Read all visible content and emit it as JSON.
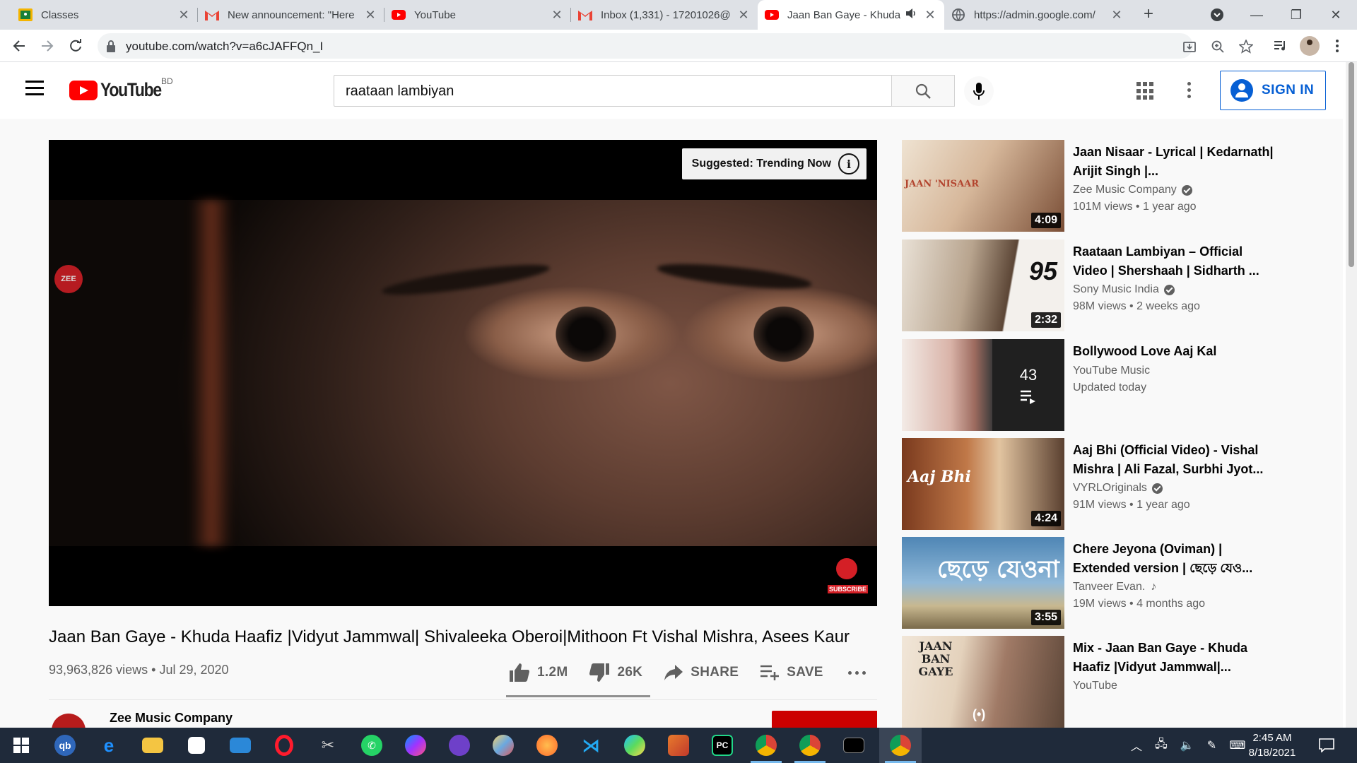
{
  "browser": {
    "tabs": [
      {
        "title": "Classes",
        "favicon": "classroom-icon",
        "active": false
      },
      {
        "title": "New announcement: \"Here",
        "favicon": "gmail-icon",
        "active": false
      },
      {
        "title": "YouTube",
        "favicon": "youtube-icon",
        "active": false
      },
      {
        "title": "Inbox (1,331) - 17201026@",
        "favicon": "gmail-icon",
        "active": false
      },
      {
        "title": "Jaan Ban Gaye - Khuda",
        "favicon": "youtube-icon",
        "active": true,
        "muted_icon": "speaker-icon"
      },
      {
        "title": "https://admin.google.com/",
        "favicon": "globe-icon",
        "active": false
      }
    ],
    "url": "youtube.com/watch?v=a6cJAFFQn_I"
  },
  "youtube": {
    "logo_text": "YouTube",
    "country_code": "BD",
    "search_query": "raataan lambiyan",
    "sign_in_label": "SIGN IN"
  },
  "player": {
    "suggested_label": "Suggested: Trending Now",
    "info_glyph": "i",
    "zee_logo": "ZEE",
    "subscribe_overlay": "SUBSCRIBE"
  },
  "video": {
    "title": "Jaan Ban Gaye - Khuda Haafiz |Vidyut Jammwal| Shivaleeka Oberoi|Mithoon Ft Vishal Mishra, Asees Kaur",
    "views": "93,963,826 views",
    "date": "Jul 29, 2020",
    "likes": "1.2M",
    "dislikes": "26K",
    "share_label": "SHARE",
    "save_label": "SAVE",
    "like_ratio": 0.979,
    "channel_name": "Zee Music Company"
  },
  "recommendations": [
    {
      "title": "Jaan Nisaar - Lyrical | Kedarnath| Arijit Singh |...",
      "channel": "Zee Music Company",
      "verified": true,
      "stats": "101M views • 1 year ago",
      "duration": "4:09",
      "thumb_text": "JAAN 'NISAAR",
      "thumb_colors": [
        "#d8c2a8",
        "#9a6a4a"
      ]
    },
    {
      "title": "Raataan Lambiyan – Official Video | Shershaah | Sidharth ...",
      "channel": "Sony Music India",
      "verified": true,
      "stats": "98M views • 2 weeks ago",
      "duration": "2:32",
      "thumb_text": "95",
      "thumb_colors": [
        "#c7b9a4",
        "#6b5a4a"
      ]
    },
    {
      "title": "Bollywood Love Aaj Kal",
      "channel": "YouTube Music",
      "verified": false,
      "stats": "Updated today",
      "playlist_count": "43",
      "thumb_colors": [
        "#e8d8d0",
        "#b88a7a"
      ]
    },
    {
      "title": "Aaj Bhi (Official Video) - Vishal Mishra | Ali Fazal, Surbhi Jyot...",
      "channel": "VYRLOriginals",
      "verified": true,
      "stats": "91M views • 1 year ago",
      "duration": "4:24",
      "thumb_text": "Aaj Bhi",
      "thumb_colors": [
        "#8a4a2a",
        "#d8a070"
      ]
    },
    {
      "title": "Chere Jeyona (Oviman) | Extended version | ছেড়ে যেও...",
      "channel": "Tanveer Evan.",
      "music_note": true,
      "stats": "19M views • 4 months ago",
      "duration": "3:55",
      "thumb_text": "ছেড়ে যেওনা",
      "thumb_colors": [
        "#5a8ab0",
        "#c8d8e0"
      ]
    },
    {
      "title": "Mix - Jaan Ban Gaye - Khuda Haafiz |Vidyut Jammwal|...",
      "channel": "YouTube",
      "verified": false,
      "stats": "",
      "live_icon": "(•)",
      "thumb_text": "JAAN BAN GAYE",
      "thumb_colors": [
        "#e0d0c0",
        "#8a6a5a"
      ]
    }
  ],
  "taskbar": {
    "apps": [
      "windows-start-icon",
      "qbittorrent-icon",
      "edge-icon",
      "file-explorer-icon",
      "store-icon",
      "mail-icon",
      "opera-icon",
      "snipping-icon",
      "whatsapp-icon",
      "messenger-icon",
      "github-icon",
      "paint-icon",
      "firefox-icon",
      "vscode-icon",
      "paint3d-icon",
      "matlab-icon",
      "pycharm-icon",
      "chrome-profile-icon",
      "chrome-icon",
      "terminal-icon",
      "chrome-active-icon"
    ],
    "time": "2:45 AM",
    "date": "8/18/2021"
  },
  "colors": {
    "youtube_red": "#ff0000",
    "link_blue": "#065fd4",
    "taskbar": "#1f2a3a"
  }
}
